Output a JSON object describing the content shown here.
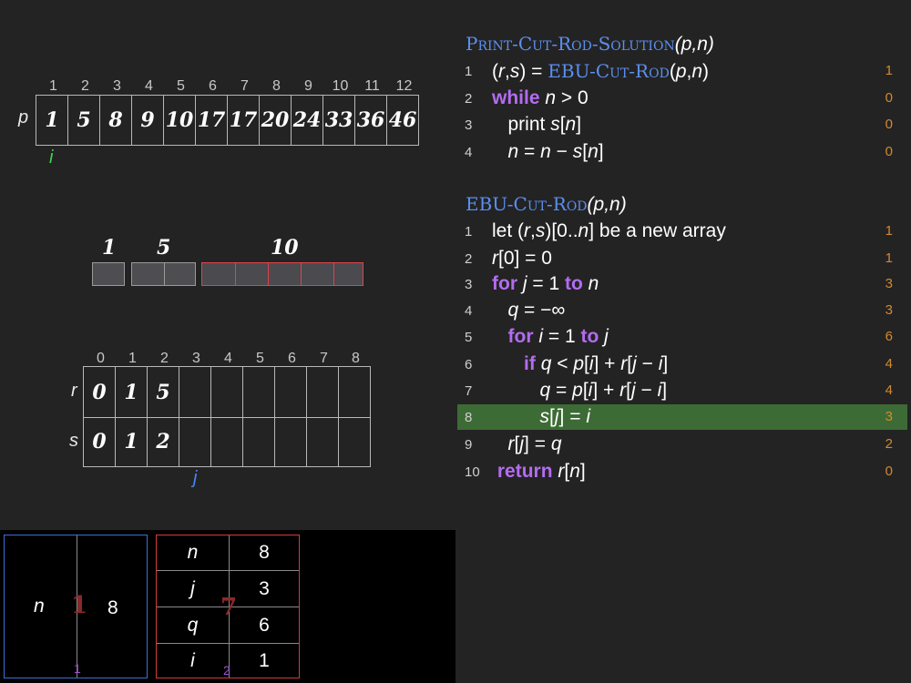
{
  "p_array": {
    "label": "p",
    "indices": [
      "1",
      "2",
      "3",
      "4",
      "5",
      "6",
      "7",
      "8",
      "9",
      "10",
      "11",
      "12"
    ],
    "values": [
      "1",
      "5",
      "8",
      "9",
      "10",
      "17",
      "17",
      "20",
      "24",
      "33",
      "36",
      "46"
    ],
    "pointer": "i"
  },
  "rod_pieces": {
    "labels": [
      "1",
      "5",
      "10"
    ]
  },
  "rs_table": {
    "indices": [
      "0",
      "1",
      "2",
      "3",
      "4",
      "5",
      "6",
      "7",
      "8"
    ],
    "r_label": "r",
    "s_label": "s",
    "r_values": [
      "0",
      "1",
      "5",
      "",
      "",
      "",
      "",
      "",
      ""
    ],
    "s_values": [
      "0",
      "1",
      "2",
      "",
      "",
      "",
      "",
      "",
      ""
    ],
    "pointer": "j"
  },
  "code": {
    "print_header_proc": "Print-Cut-Rod-Solution",
    "print_header_args": "(p,n)",
    "print_lines": [
      {
        "num": "1",
        "count": "1"
      },
      {
        "num": "2",
        "count": "0"
      },
      {
        "num": "3",
        "count": "0"
      },
      {
        "num": "4",
        "count": "0"
      }
    ],
    "ebu_header_proc": "EBU-Cut-Rod",
    "ebu_header_args": "(p,n)",
    "ebu_lines": [
      {
        "num": "1",
        "count": "1"
      },
      {
        "num": "2",
        "count": "1"
      },
      {
        "num": "3",
        "count": "3"
      },
      {
        "num": "4",
        "count": "3"
      },
      {
        "num": "5",
        "count": "6"
      },
      {
        "num": "6",
        "count": "4"
      },
      {
        "num": "7",
        "count": "4"
      },
      {
        "num": "8",
        "count": "3"
      },
      {
        "num": "9",
        "count": "2"
      },
      {
        "num": "10",
        "count": "0"
      }
    ],
    "highlighted_line": "8"
  },
  "frame1": {
    "var": "n",
    "value": "8",
    "marker": "1",
    "footer": "1"
  },
  "frame2": {
    "rows": [
      {
        "var": "n",
        "value": "8"
      },
      {
        "var": "j",
        "value": "3"
      },
      {
        "var": "q",
        "value": "6"
      },
      {
        "var": "i",
        "value": "1"
      }
    ],
    "marker": "7",
    "footer": "2"
  },
  "colors": {
    "keyword": "#b36cf0",
    "procedure": "#5b8ff0",
    "count": "#d4892e",
    "highlight": "#3d6b35",
    "frame_blue": "#3a6fd8",
    "frame_red": "#d43a3a"
  }
}
